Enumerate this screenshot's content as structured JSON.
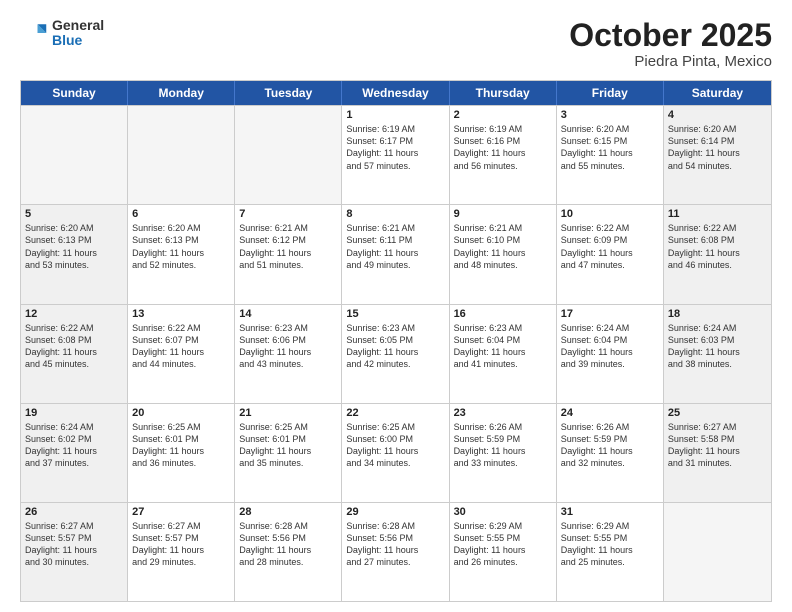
{
  "header": {
    "logo_general": "General",
    "logo_blue": "Blue",
    "title": "October 2025",
    "subtitle": "Piedra Pinta, Mexico"
  },
  "days_of_week": [
    "Sunday",
    "Monday",
    "Tuesday",
    "Wednesday",
    "Thursday",
    "Friday",
    "Saturday"
  ],
  "weeks": [
    [
      {
        "day": "",
        "info": "",
        "shaded": true
      },
      {
        "day": "",
        "info": "",
        "shaded": true
      },
      {
        "day": "",
        "info": "",
        "shaded": true
      },
      {
        "day": "1",
        "info": "Sunrise: 6:19 AM\nSunset: 6:17 PM\nDaylight: 11 hours\nand 57 minutes.",
        "shaded": false
      },
      {
        "day": "2",
        "info": "Sunrise: 6:19 AM\nSunset: 6:16 PM\nDaylight: 11 hours\nand 56 minutes.",
        "shaded": false
      },
      {
        "day": "3",
        "info": "Sunrise: 6:20 AM\nSunset: 6:15 PM\nDaylight: 11 hours\nand 55 minutes.",
        "shaded": false
      },
      {
        "day": "4",
        "info": "Sunrise: 6:20 AM\nSunset: 6:14 PM\nDaylight: 11 hours\nand 54 minutes.",
        "shaded": true
      }
    ],
    [
      {
        "day": "5",
        "info": "Sunrise: 6:20 AM\nSunset: 6:13 PM\nDaylight: 11 hours\nand 53 minutes.",
        "shaded": true
      },
      {
        "day": "6",
        "info": "Sunrise: 6:20 AM\nSunset: 6:13 PM\nDaylight: 11 hours\nand 52 minutes.",
        "shaded": false
      },
      {
        "day": "7",
        "info": "Sunrise: 6:21 AM\nSunset: 6:12 PM\nDaylight: 11 hours\nand 51 minutes.",
        "shaded": false
      },
      {
        "day": "8",
        "info": "Sunrise: 6:21 AM\nSunset: 6:11 PM\nDaylight: 11 hours\nand 49 minutes.",
        "shaded": false
      },
      {
        "day": "9",
        "info": "Sunrise: 6:21 AM\nSunset: 6:10 PM\nDaylight: 11 hours\nand 48 minutes.",
        "shaded": false
      },
      {
        "day": "10",
        "info": "Sunrise: 6:22 AM\nSunset: 6:09 PM\nDaylight: 11 hours\nand 47 minutes.",
        "shaded": false
      },
      {
        "day": "11",
        "info": "Sunrise: 6:22 AM\nSunset: 6:08 PM\nDaylight: 11 hours\nand 46 minutes.",
        "shaded": true
      }
    ],
    [
      {
        "day": "12",
        "info": "Sunrise: 6:22 AM\nSunset: 6:08 PM\nDaylight: 11 hours\nand 45 minutes.",
        "shaded": true
      },
      {
        "day": "13",
        "info": "Sunrise: 6:22 AM\nSunset: 6:07 PM\nDaylight: 11 hours\nand 44 minutes.",
        "shaded": false
      },
      {
        "day": "14",
        "info": "Sunrise: 6:23 AM\nSunset: 6:06 PM\nDaylight: 11 hours\nand 43 minutes.",
        "shaded": false
      },
      {
        "day": "15",
        "info": "Sunrise: 6:23 AM\nSunset: 6:05 PM\nDaylight: 11 hours\nand 42 minutes.",
        "shaded": false
      },
      {
        "day": "16",
        "info": "Sunrise: 6:23 AM\nSunset: 6:04 PM\nDaylight: 11 hours\nand 41 minutes.",
        "shaded": false
      },
      {
        "day": "17",
        "info": "Sunrise: 6:24 AM\nSunset: 6:04 PM\nDaylight: 11 hours\nand 39 minutes.",
        "shaded": false
      },
      {
        "day": "18",
        "info": "Sunrise: 6:24 AM\nSunset: 6:03 PM\nDaylight: 11 hours\nand 38 minutes.",
        "shaded": true
      }
    ],
    [
      {
        "day": "19",
        "info": "Sunrise: 6:24 AM\nSunset: 6:02 PM\nDaylight: 11 hours\nand 37 minutes.",
        "shaded": true
      },
      {
        "day": "20",
        "info": "Sunrise: 6:25 AM\nSunset: 6:01 PM\nDaylight: 11 hours\nand 36 minutes.",
        "shaded": false
      },
      {
        "day": "21",
        "info": "Sunrise: 6:25 AM\nSunset: 6:01 PM\nDaylight: 11 hours\nand 35 minutes.",
        "shaded": false
      },
      {
        "day": "22",
        "info": "Sunrise: 6:25 AM\nSunset: 6:00 PM\nDaylight: 11 hours\nand 34 minutes.",
        "shaded": false
      },
      {
        "day": "23",
        "info": "Sunrise: 6:26 AM\nSunset: 5:59 PM\nDaylight: 11 hours\nand 33 minutes.",
        "shaded": false
      },
      {
        "day": "24",
        "info": "Sunrise: 6:26 AM\nSunset: 5:59 PM\nDaylight: 11 hours\nand 32 minutes.",
        "shaded": false
      },
      {
        "day": "25",
        "info": "Sunrise: 6:27 AM\nSunset: 5:58 PM\nDaylight: 11 hours\nand 31 minutes.",
        "shaded": true
      }
    ],
    [
      {
        "day": "26",
        "info": "Sunrise: 6:27 AM\nSunset: 5:57 PM\nDaylight: 11 hours\nand 30 minutes.",
        "shaded": true
      },
      {
        "day": "27",
        "info": "Sunrise: 6:27 AM\nSunset: 5:57 PM\nDaylight: 11 hours\nand 29 minutes.",
        "shaded": false
      },
      {
        "day": "28",
        "info": "Sunrise: 6:28 AM\nSunset: 5:56 PM\nDaylight: 11 hours\nand 28 minutes.",
        "shaded": false
      },
      {
        "day": "29",
        "info": "Sunrise: 6:28 AM\nSunset: 5:56 PM\nDaylight: 11 hours\nand 27 minutes.",
        "shaded": false
      },
      {
        "day": "30",
        "info": "Sunrise: 6:29 AM\nSunset: 5:55 PM\nDaylight: 11 hours\nand 26 minutes.",
        "shaded": false
      },
      {
        "day": "31",
        "info": "Sunrise: 6:29 AM\nSunset: 5:55 PM\nDaylight: 11 hours\nand 25 minutes.",
        "shaded": false
      },
      {
        "day": "",
        "info": "",
        "shaded": true
      }
    ]
  ]
}
